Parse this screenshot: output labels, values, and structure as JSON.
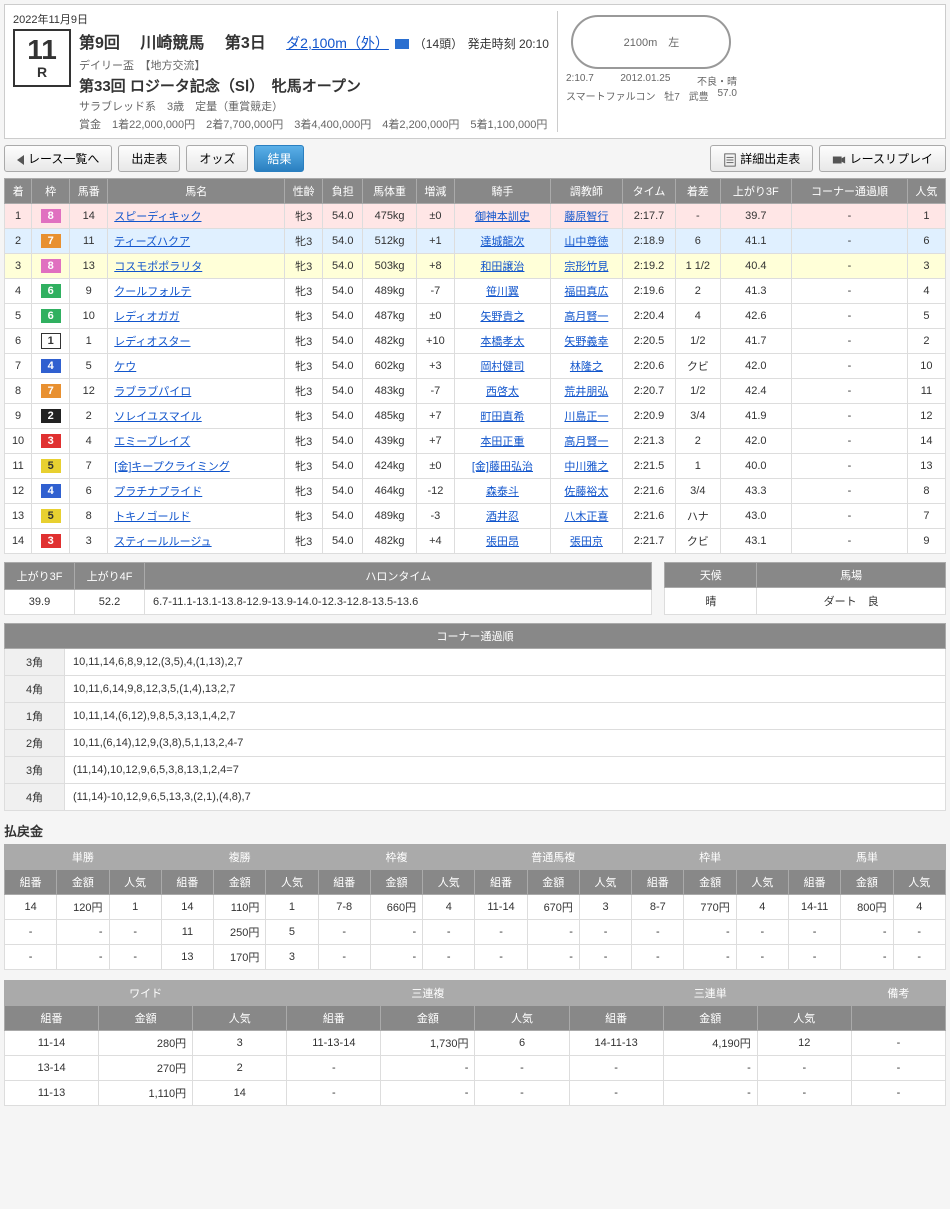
{
  "header": {
    "date": "2022年11月9日",
    "meeting": "第9回",
    "venue": "川崎競馬",
    "day": "第3日",
    "distance_link": "ダ2,100m（外）",
    "horses": "（14頭）",
    "start_time": "発走時刻 20:10",
    "cup": "デイリー盃",
    "exchange": "【地方交流】",
    "race_name": "第33回 ロジータ記念（SⅠ）　牝馬オープン",
    "cond": "サラブレッド系　3歳　定量（重賞競走）",
    "prize_label": "賞金",
    "prize": "1着22,000,000円　2着7,700,000円　3着4,400,000円　4着2,200,000円　5着1,100,000円",
    "race_no": "11",
    "race_r": "R",
    "track_label": "2100m　左",
    "record_time": "2:10.7",
    "record_date": "2012.01.25",
    "record_cond": "不良・晴",
    "record_horse": "スマートファルコン",
    "record_sex": "牡7",
    "record_jockey": "武豊",
    "record_wt": "57.0"
  },
  "nav": {
    "back": "レース一覧へ",
    "entries": "出走表",
    "odds": "オッズ",
    "result": "結果",
    "detail": "詳細出走表",
    "replay": "レースリプレイ"
  },
  "cols": [
    "着",
    "枠",
    "馬番",
    "馬名",
    "性齡",
    "負担",
    "馬体重",
    "増減",
    "騎手",
    "調教師",
    "タイム",
    "着差",
    "上がり3F",
    "コーナー通過順",
    "人気"
  ],
  "rows": [
    {
      "pos": "1",
      "waku": "8",
      "num": "14",
      "name": "スピーディキック",
      "sa": "牝3",
      "wt": "54.0",
      "bw": "475kg",
      "diff": "±0",
      "jk": "御神本訓史",
      "tr": "藤原智行",
      "time": "2:17.7",
      "mgn": "-",
      "f3": "39.7",
      "corner": "-",
      "pop": "1"
    },
    {
      "pos": "2",
      "waku": "7",
      "num": "11",
      "name": "ティーズハクア",
      "sa": "牝3",
      "wt": "54.0",
      "bw": "512kg",
      "diff": "+1",
      "jk": "達城龍次",
      "tr": "山中尊徳",
      "time": "2:18.9",
      "mgn": "6",
      "f3": "41.1",
      "corner": "-",
      "pop": "6"
    },
    {
      "pos": "3",
      "waku": "8",
      "num": "13",
      "name": "コスモポポラリタ",
      "sa": "牝3",
      "wt": "54.0",
      "bw": "503kg",
      "diff": "+8",
      "jk": "和田譲治",
      "tr": "宗形竹見",
      "time": "2:19.2",
      "mgn": "1 1/2",
      "f3": "40.4",
      "corner": "-",
      "pop": "3"
    },
    {
      "pos": "4",
      "waku": "6",
      "num": "9",
      "name": "クールフォルテ",
      "sa": "牝3",
      "wt": "54.0",
      "bw": "489kg",
      "diff": "-7",
      "jk": "笹川翼",
      "tr": "福田真広",
      "time": "2:19.6",
      "mgn": "2",
      "f3": "41.3",
      "corner": "-",
      "pop": "4"
    },
    {
      "pos": "5",
      "waku": "6",
      "num": "10",
      "name": "レディオガガ",
      "sa": "牝3",
      "wt": "54.0",
      "bw": "487kg",
      "diff": "±0",
      "jk": "矢野貴之",
      "tr": "高月賢一",
      "time": "2:20.4",
      "mgn": "4",
      "f3": "42.6",
      "corner": "-",
      "pop": "5"
    },
    {
      "pos": "6",
      "waku": "1",
      "num": "1",
      "name": "レディオスター",
      "sa": "牝3",
      "wt": "54.0",
      "bw": "482kg",
      "diff": "+10",
      "jk": "本橋孝太",
      "tr": "矢野義幸",
      "time": "2:20.5",
      "mgn": "1/2",
      "f3": "41.7",
      "corner": "-",
      "pop": "2"
    },
    {
      "pos": "7",
      "waku": "4",
      "num": "5",
      "name": "ケウ",
      "sa": "牝3",
      "wt": "54.0",
      "bw": "602kg",
      "diff": "+3",
      "jk": "岡村健司",
      "tr": "林隆之",
      "time": "2:20.6",
      "mgn": "クビ",
      "f3": "42.0",
      "corner": "-",
      "pop": "10"
    },
    {
      "pos": "8",
      "waku": "7",
      "num": "12",
      "name": "ラブラブパイロ",
      "sa": "牝3",
      "wt": "54.0",
      "bw": "483kg",
      "diff": "-7",
      "jk": "西啓太",
      "tr": "荒井朋弘",
      "time": "2:20.7",
      "mgn": "1/2",
      "f3": "42.4",
      "corner": "-",
      "pop": "11"
    },
    {
      "pos": "9",
      "waku": "2",
      "num": "2",
      "name": "ソレイユスマイル",
      "sa": "牝3",
      "wt": "54.0",
      "bw": "485kg",
      "diff": "+7",
      "jk": "町田直希",
      "tr": "川島正一",
      "time": "2:20.9",
      "mgn": "3/4",
      "f3": "41.9",
      "corner": "-",
      "pop": "12"
    },
    {
      "pos": "10",
      "waku": "3",
      "num": "4",
      "name": "エミーブレイズ",
      "sa": "牝3",
      "wt": "54.0",
      "bw": "439kg",
      "diff": "+7",
      "jk": "本田正重",
      "tr": "高月賢一",
      "time": "2:21.3",
      "mgn": "2",
      "f3": "42.0",
      "corner": "-",
      "pop": "14"
    },
    {
      "pos": "11",
      "waku": "5",
      "num": "7",
      "name": "[金]キープクライミング",
      "sa": "牝3",
      "wt": "54.0",
      "bw": "424kg",
      "diff": "±0",
      "jk": "[金]藤田弘治",
      "tr": "中川雅之",
      "time": "2:21.5",
      "mgn": "1",
      "f3": "40.0",
      "corner": "-",
      "pop": "13"
    },
    {
      "pos": "12",
      "waku": "4",
      "num": "6",
      "name": "プラチナプライド",
      "sa": "牝3",
      "wt": "54.0",
      "bw": "464kg",
      "diff": "-12",
      "jk": "森泰斗",
      "tr": "佐藤裕太",
      "time": "2:21.6",
      "mgn": "3/4",
      "f3": "43.3",
      "corner": "-",
      "pop": "8"
    },
    {
      "pos": "13",
      "waku": "5",
      "num": "8",
      "name": "トキノゴールド",
      "sa": "牝3",
      "wt": "54.0",
      "bw": "489kg",
      "diff": "-3",
      "jk": "酒井忍",
      "tr": "八木正喜",
      "time": "2:21.6",
      "mgn": "ハナ",
      "f3": "43.0",
      "corner": "-",
      "pop": "7"
    },
    {
      "pos": "14",
      "waku": "3",
      "num": "3",
      "name": "スティールルージュ",
      "sa": "牝3",
      "wt": "54.0",
      "bw": "482kg",
      "diff": "+4",
      "jk": "張田昂",
      "tr": "張田京",
      "time": "2:21.7",
      "mgn": "クビ",
      "f3": "43.1",
      "corner": "-",
      "pop": "9"
    }
  ],
  "lap": {
    "h": {
      "f3": "上がり3F",
      "f4": "上がり4F",
      "ht": "ハロンタイム",
      "weather": "天候",
      "going": "馬場"
    },
    "f3": "39.9",
    "f4": "52.2",
    "halon": "6.7-11.1-13.1-13.8-12.9-13.9-14.0-12.3-12.8-13.5-13.6",
    "weather": "晴",
    "going": "ダート　良"
  },
  "corner": {
    "title": "コーナー通過順",
    "rows": [
      {
        "lbl": "3角",
        "val": "10,11,14,6,8,9,12,(3,5),4,(1,13),2,7"
      },
      {
        "lbl": "4角",
        "val": "10,11,6,14,9,8,12,3,5,(1,4),13,2,7"
      },
      {
        "lbl": "1角",
        "val": "10,11,14,(6,12),9,8,5,3,13,1,4,2,7"
      },
      {
        "lbl": "2角",
        "val": "10,11,(6,14),12,9,(3,8),5,1,13,2,4-7"
      },
      {
        "lbl": "3角",
        "val": "(11,14),10,12,9,6,5,3,8,13,1,2,4=7"
      },
      {
        "lbl": "4角",
        "val": "(11,14)-10,12,9,6,5,13,3,(2,1),(4,8),7"
      }
    ]
  },
  "payout_title": "払戻金",
  "payout1": {
    "cats": [
      "単勝",
      "複勝",
      "枠複",
      "普通馬複",
      "枠単",
      "馬単"
    ],
    "sub": [
      "組番",
      "金額",
      "人気"
    ],
    "rows": [
      [
        "14",
        "120円",
        "1",
        "14",
        "110円",
        "1",
        "7-8",
        "660円",
        "4",
        "11-14",
        "670円",
        "3",
        "8-7",
        "770円",
        "4",
        "14-11",
        "800円",
        "4"
      ],
      [
        "-",
        "-",
        "-",
        "11",
        "250円",
        "5",
        "-",
        "-",
        "-",
        "-",
        "-",
        "-",
        "-",
        "-",
        "-",
        "-",
        "-",
        "-"
      ],
      [
        "-",
        "-",
        "-",
        "13",
        "170円",
        "3",
        "-",
        "-",
        "-",
        "-",
        "-",
        "-",
        "-",
        "-",
        "-",
        "-",
        "-",
        "-"
      ]
    ]
  },
  "payout2": {
    "cats": [
      "ワイド",
      "三連複",
      "三連単",
      "備考"
    ],
    "sub": [
      "組番",
      "金額",
      "人気"
    ],
    "rows": [
      [
        "11-14",
        "280円",
        "3",
        "11-13-14",
        "1,730円",
        "6",
        "14-11-13",
        "4,190円",
        "12",
        "-"
      ],
      [
        "13-14",
        "270円",
        "2",
        "-",
        "-",
        "-",
        "-",
        "-",
        "-",
        "-"
      ],
      [
        "11-13",
        "1,110円",
        "14",
        "-",
        "-",
        "-",
        "-",
        "-",
        "-",
        "-"
      ]
    ]
  }
}
